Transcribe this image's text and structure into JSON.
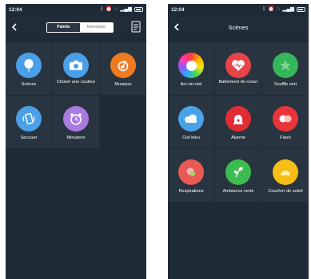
{
  "left_screen": {
    "status": {
      "time": "12:04"
    },
    "tabs": {
      "palette": "Palette",
      "interaction": "Interaction"
    },
    "tiles": [
      {
        "label": "Scènes",
        "icon": "balloon-icon",
        "color": "#4a9fe8"
      },
      {
        "label": "Choisir une couleur",
        "icon": "camera-icon",
        "color": "#4a9fe8"
      },
      {
        "label": "Musique",
        "icon": "music-note-icon",
        "color": "#f07b1f"
      },
      {
        "label": "Secouer",
        "icon": "shake-phone-icon",
        "color": "#4a9fe8"
      },
      {
        "label": "Minuterie",
        "icon": "alarm-clock-icon",
        "color": "#a97ae0"
      }
    ]
  },
  "right_screen": {
    "status": {
      "time": "12:04"
    },
    "title": "Scènes",
    "tiles": [
      {
        "label": "Arc-en-ciel",
        "icon": "rainbow-icon"
      },
      {
        "label": "Battement de coeur",
        "icon": "heart-icon",
        "color": "#e84448"
      },
      {
        "label": "Souffle vert",
        "icon": "leaf-icon",
        "color": "#36b65a"
      },
      {
        "label": "Ciel bleu",
        "icon": "cloud-icon",
        "color": "#4aa3e8"
      },
      {
        "label": "Alarme",
        "icon": "alarm-siren-icon",
        "color": "#e02c35"
      },
      {
        "label": "Flash",
        "icon": "flash-icon",
        "color": "#e8343a"
      },
      {
        "label": "Respirations",
        "icon": "breathing-icon",
        "color": "#e85a55"
      },
      {
        "label": "Ambiance verte",
        "icon": "sprout-icon",
        "color": "#3cbc50"
      },
      {
        "label": "Coucher de soleil",
        "icon": "sunset-icon",
        "color": "#f5be16"
      }
    ]
  }
}
